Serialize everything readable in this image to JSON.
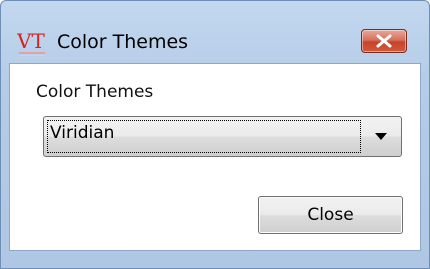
{
  "window": {
    "title": "Color Themes",
    "logo_text": "VT",
    "logo_icon": "vt-logo-icon",
    "close_icon": "close-x-icon"
  },
  "dialog": {
    "group_label": "Color Themes",
    "theme_select": {
      "selected_value": "Viridian"
    },
    "close_button_label": "Close"
  },
  "colors": {
    "logo_red": "#d4221c",
    "close_red": "#c7432b",
    "title_bar": "#b5cce8"
  }
}
